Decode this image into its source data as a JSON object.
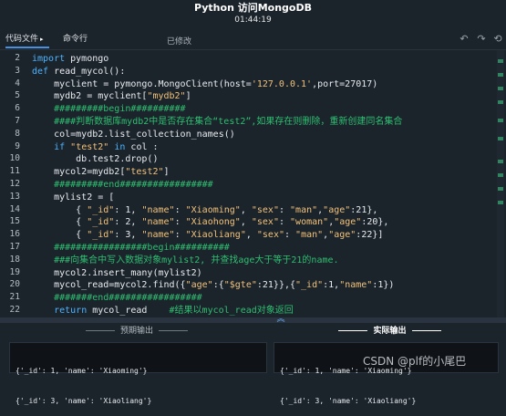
{
  "window": {
    "title": "Python 访问MongoDB",
    "timer": "01:44:19"
  },
  "tabs": [
    {
      "label": "代码文件",
      "caret": "▸"
    },
    {
      "label": "命令行"
    }
  ],
  "status": "已修改",
  "icons": [
    "undo-icon",
    "redo-icon",
    "reset-icon"
  ],
  "editor": {
    "line_numbers": [
      "2",
      "3",
      "4",
      "5",
      "6",
      "7",
      "8",
      "9",
      "10",
      "11",
      "12",
      "13",
      "14",
      "15",
      "16",
      "17",
      "18",
      "19",
      "20",
      "21",
      "22"
    ],
    "lines": [
      [
        {
          "t": "import",
          "c": "kw"
        },
        {
          "t": " pymongo",
          "c": ""
        }
      ],
      [
        {
          "t": "def",
          "c": "kw"
        },
        {
          "t": " read_mycol():",
          "c": ""
        }
      ],
      [
        {
          "t": "    myclient = pymongo.MongoClient(host=",
          "c": ""
        },
        {
          "t": "'127.0.0.1'",
          "c": "str"
        },
        {
          "t": ",port=27017)",
          "c": ""
        }
      ],
      [
        {
          "t": "    mydb2 = myclient[",
          "c": ""
        },
        {
          "t": "\"mydb2\"",
          "c": "str"
        },
        {
          "t": "]",
          "c": ""
        }
      ],
      [
        {
          "t": "    #########begin##########",
          "c": "cm"
        }
      ],
      [
        {
          "t": "    ####判断数据库mydb2中是否存在集合“test2”,如果存在则删除，重新创建同名集合",
          "c": "cm"
        }
      ],
      [
        {
          "t": "    col=mydb2.list_collection_names()",
          "c": ""
        }
      ],
      [
        {
          "t": "    ",
          "c": ""
        },
        {
          "t": "if",
          "c": "kw"
        },
        {
          "t": " ",
          "c": ""
        },
        {
          "t": "\"test2\"",
          "c": "str"
        },
        {
          "t": " ",
          "c": ""
        },
        {
          "t": "in",
          "c": "kw"
        },
        {
          "t": " col :",
          "c": ""
        }
      ],
      [
        {
          "t": "        db.test2.drop()",
          "c": ""
        }
      ],
      [
        {
          "t": "    mycol2=mydb2[",
          "c": ""
        },
        {
          "t": "\"test2\"",
          "c": "str"
        },
        {
          "t": "]",
          "c": ""
        }
      ],
      [
        {
          "t": "    #########end#################",
          "c": "cm"
        }
      ],
      [
        {
          "t": "    mylist2 = [",
          "c": ""
        }
      ],
      [
        {
          "t": "        { ",
          "c": ""
        },
        {
          "t": "\"_id\"",
          "c": "str"
        },
        {
          "t": ": 1, ",
          "c": ""
        },
        {
          "t": "\"name\"",
          "c": "str"
        },
        {
          "t": ": ",
          "c": ""
        },
        {
          "t": "\"Xiaoming\"",
          "c": "str"
        },
        {
          "t": ", ",
          "c": ""
        },
        {
          "t": "\"sex\"",
          "c": "str"
        },
        {
          "t": ": ",
          "c": ""
        },
        {
          "t": "\"man\"",
          "c": "str"
        },
        {
          "t": ",",
          "c": ""
        },
        {
          "t": "\"age\"",
          "c": "str"
        },
        {
          "t": ":21},",
          "c": ""
        }
      ],
      [
        {
          "t": "        { ",
          "c": ""
        },
        {
          "t": "\"_id\"",
          "c": "str"
        },
        {
          "t": ": 2, ",
          "c": ""
        },
        {
          "t": "\"name\"",
          "c": "str"
        },
        {
          "t": ": ",
          "c": ""
        },
        {
          "t": "\"Xiaohong\"",
          "c": "str"
        },
        {
          "t": ", ",
          "c": ""
        },
        {
          "t": "\"sex\"",
          "c": "str"
        },
        {
          "t": ": ",
          "c": ""
        },
        {
          "t": "\"woman\"",
          "c": "str"
        },
        {
          "t": ",",
          "c": ""
        },
        {
          "t": "\"age\"",
          "c": "str"
        },
        {
          "t": ":20},",
          "c": ""
        }
      ],
      [
        {
          "t": "        { ",
          "c": ""
        },
        {
          "t": "\"_id\"",
          "c": "str"
        },
        {
          "t": ": 3, ",
          "c": ""
        },
        {
          "t": "\"name\"",
          "c": "str"
        },
        {
          "t": ": ",
          "c": ""
        },
        {
          "t": "\"Xiaoliang\"",
          "c": "str"
        },
        {
          "t": ", ",
          "c": ""
        },
        {
          "t": "\"sex\"",
          "c": "str"
        },
        {
          "t": ": ",
          "c": ""
        },
        {
          "t": "\"man\"",
          "c": "str"
        },
        {
          "t": ",",
          "c": ""
        },
        {
          "t": "\"age\"",
          "c": "str"
        },
        {
          "t": ":22}]",
          "c": ""
        }
      ],
      [
        {
          "t": "    #################begin##########",
          "c": "cm"
        }
      ],
      [
        {
          "t": "    ###向集合中写入数据对象mylist2, 并查找age大于等于21的name.",
          "c": "cm"
        }
      ],
      [
        {
          "t": "    mycol2.insert_many(mylist2)",
          "c": ""
        }
      ],
      [
        {
          "t": "    mycol_read=mycol2.find({",
          "c": ""
        },
        {
          "t": "\"age\"",
          "c": "str"
        },
        {
          "t": ":{",
          "c": ""
        },
        {
          "t": "\"$gte\"",
          "c": "str"
        },
        {
          "t": ":21}},{",
          "c": ""
        },
        {
          "t": "\"_id\"",
          "c": "str"
        },
        {
          "t": ":1,",
          "c": ""
        },
        {
          "t": "\"name\"",
          "c": "str"
        },
        {
          "t": ":1})",
          "c": ""
        }
      ],
      [
        {
          "t": "    #######end#################",
          "c": "cm"
        }
      ],
      [
        {
          "t": "    ",
          "c": ""
        },
        {
          "t": "return",
          "c": "kw"
        },
        {
          "t": " mycol_read    ",
          "c": ""
        },
        {
          "t": "#结果以mycol_read对象返回",
          "c": "cm"
        }
      ]
    ]
  },
  "output": {
    "expected_label": "预期输出",
    "actual_label": "实际输出",
    "expected": [
      "{'_id': 1, 'name': 'Xiaoming'}",
      "{'_id': 3, 'name': 'Xiaoliang'}"
    ],
    "actual": [
      "{'_id': 1, 'name': 'Xiaoming'}",
      "{'_id': 3, 'name': 'Xiaoliang'}"
    ]
  },
  "watermark": "CSDN @plf的小尾巴",
  "colors": {
    "background": "#1b232b",
    "keyword": "#4db4ff",
    "string": "#f2c27a",
    "comment": "#2fbf71",
    "accent": "#4a90e2"
  }
}
